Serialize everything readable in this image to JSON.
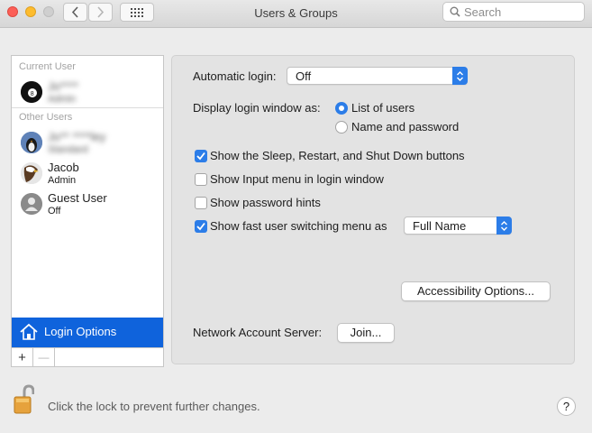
{
  "window": {
    "title": "Users & Groups"
  },
  "search": {
    "placeholder": "Search"
  },
  "sidebar": {
    "current_user_header": "Current User",
    "current_user": {
      "name": "Jo**** ",
      "role": "Admin"
    },
    "others_header": "Other Users",
    "users": [
      {
        "name": "Jo** ****ley",
        "role": "Standard",
        "blurred": true
      },
      {
        "name": "Jacob",
        "role": "Admin",
        "blurred": false
      },
      {
        "name": "Guest User",
        "role": "Off",
        "blurred": false
      }
    ],
    "login_options_label": "Login Options",
    "add_symbol": "+",
    "remove_symbol": "—"
  },
  "settings": {
    "automatic_login_label": "Automatic login:",
    "automatic_login_value": "Off",
    "display_login_label": "Display login window as:",
    "display_login_options": [
      "List of users",
      "Name and password"
    ],
    "display_login_selected": "List of users",
    "checkboxes": [
      {
        "label": "Show the Sleep, Restart, and Shut Down buttons",
        "checked": true
      },
      {
        "label": "Show Input menu in login window",
        "checked": false
      },
      {
        "label": "Show password hints",
        "checked": false
      },
      {
        "label": "Show fast user switching menu as",
        "checked": true
      }
    ],
    "fast_switch_value": "Full Name",
    "accessibility_button": "Accessibility Options...",
    "network_server_label": "Network Account Server:",
    "join_button": "Join..."
  },
  "footer": {
    "lock_text": "Click the lock to prevent further changes.",
    "help_symbol": "?"
  },
  "colors": {
    "accent": "#2c7de8",
    "selection": "#0f63dc"
  }
}
